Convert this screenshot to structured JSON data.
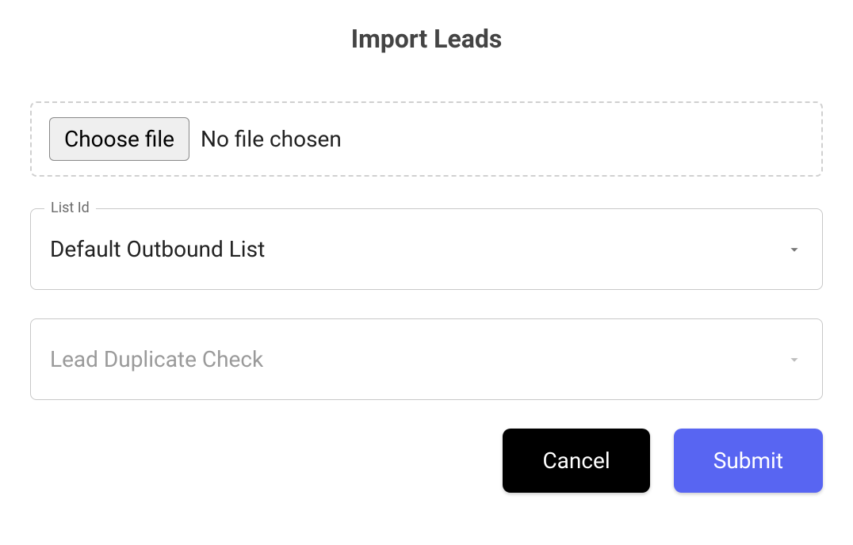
{
  "title": "Import Leads",
  "file": {
    "choose_label": "Choose file",
    "status": "No file chosen"
  },
  "list_id": {
    "label": "List Id",
    "value": "Default Outbound List"
  },
  "duplicate_check": {
    "placeholder": "Lead Duplicate Check"
  },
  "buttons": {
    "cancel": "Cancel",
    "submit": "Submit"
  },
  "colors": {
    "primary": "#5865f2",
    "cancel": "#000000"
  }
}
